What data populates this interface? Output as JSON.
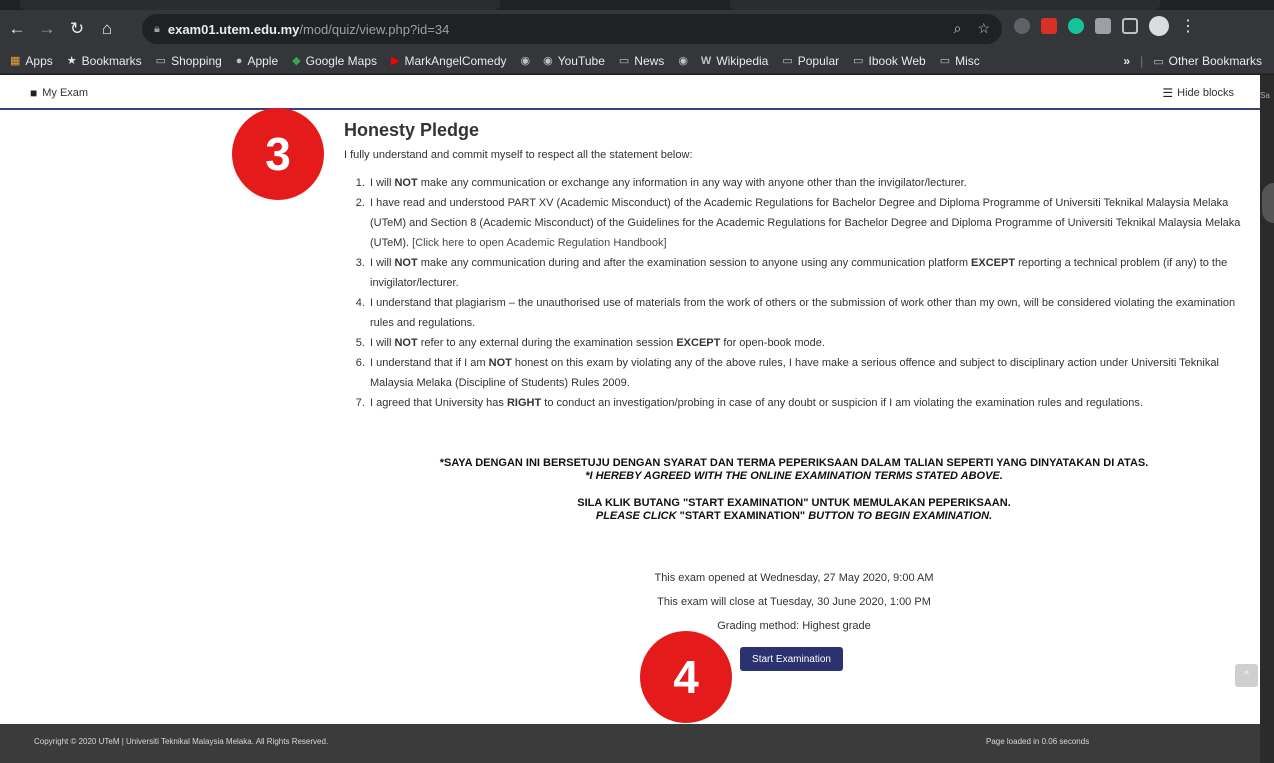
{
  "browser": {
    "url_domain": "exam01.utem.edu.my",
    "url_path": "/mod/quiz/view.php?id=34",
    "bookmarks": [
      {
        "label": "Apps",
        "icon": "apps-grid-icon"
      },
      {
        "label": "Bookmarks",
        "icon": "star-icon"
      },
      {
        "label": "Shopping",
        "icon": "folder-icon"
      },
      {
        "label": "Apple",
        "icon": "apple-icon"
      },
      {
        "label": "Google Maps",
        "icon": "maps-pin-icon"
      },
      {
        "label": "MarkAngelComedy",
        "icon": "youtube-icon"
      },
      {
        "label": "",
        "icon": "globe-icon"
      },
      {
        "label": "YouTube",
        "icon": "globe-icon"
      },
      {
        "label": "News",
        "icon": "folder-icon"
      },
      {
        "label": "",
        "icon": "globe-icon"
      },
      {
        "label": "Wikipedia",
        "icon": "wikipedia-icon"
      },
      {
        "label": "Popular",
        "icon": "folder-icon"
      },
      {
        "label": "Ibook Web",
        "icon": "folder-icon"
      },
      {
        "label": "Misc",
        "icon": "folder-icon"
      }
    ],
    "overflow_label": "»",
    "other_bookmarks": "Other Bookmarks"
  },
  "moodle": {
    "my_exam": "My Exam",
    "hide_blocks": "Hide blocks"
  },
  "pledge": {
    "title": "Honesty Pledge",
    "intro": "I fully understand and commit myself to respect all the statement below:",
    "items": [
      {
        "pre": "I will ",
        "bold": "NOT",
        "post": " make any communication or exchange any information in any way with anyone other than the invigilator/lecturer."
      },
      {
        "pre": "I have read and understood PART XV (Academic Misconduct) of the Academic Regulations for Bachelor Degree and Diploma Programme of Universiti Teknikal Malaysia Melaka (UTeM) and Section 8 (Academic Misconduct) of the Guidelines for the Academic Regulations for Bachelor Degree and Diploma Programme of Universiti Teknikal Malaysia Melaka (UTeM). ",
        "link": "[Click here to open Academic Regulation Handbook]"
      },
      {
        "pre": "I will ",
        "bold": "NOT",
        "mid": " make any communication during and after the examination session to anyone using any communication platform ",
        "bold2": "EXCEPT",
        "post": " reporting a technical problem (if any) to the invigilator/lecturer."
      },
      {
        "pre": "I understand that plagiarism – the unauthorised use of materials from the work of others or the submission of work other than my own, will be considered violating the examination rules and regulations."
      },
      {
        "pre": "I will ",
        "bold": "NOT",
        "mid": " refer to any external during the examination session ",
        "bold2": "EXCEPT",
        "post": " for open-book mode."
      },
      {
        "pre": "I understand that if I am ",
        "bold": "NOT",
        "post": " honest on this exam by violating any of the above rules, I have make a serious offence and subject to disciplinary action under Universiti Teknikal Malaysia Melaka (Discipline of Students) Rules 2009."
      },
      {
        "pre": "I agreed that University has ",
        "bold": "RIGHT",
        "post": " to conduct an investigation/probing in case of any doubt or suspicion if I am violating the examination rules and regulations."
      }
    ]
  },
  "agreement": {
    "line1": "*SAYA DENGAN INI BERSETUJU DENGAN SYARAT DAN TERMA PEPERIKSAAN DALAM TALIAN SEPERTI YANG DINYATAKAN DI ATAS.",
    "line2": "*I HEREBY AGREED WITH THE ONLINE EXAMINATION TERMS STATED ABOVE.",
    "line3": "SILA KLIK BUTANG \"START EXAMINATION\" UNTUK MEMULAKAN PEPERIKSAAN.",
    "line4a": "PLEASE CLICK",
    "line4b": " \"START EXAMINATION\" ",
    "line4c": "BUTTON TO BEGIN EXAMINATION."
  },
  "quiz_info": {
    "opened": "This exam opened at Wednesday, 27 May 2020, 9:00 AM",
    "closes": "This exam will close at Tuesday, 30 June 2020, 1:00 PM",
    "grading": "Grading method: Highest grade",
    "start_button": "Start Examination"
  },
  "footer": {
    "copyright": "Copyright © 2020 UTeM | Universiti Teknikal Malaysia Melaka. All Rights Reserved.",
    "loaded": "Page loaded in 0.06 seconds"
  },
  "badges": {
    "b3": "3",
    "b4": "4"
  },
  "side": {
    "text": "Sa"
  },
  "colors": {
    "accent": "#2a3270",
    "badge": "#e51a1a",
    "footer": "#3b3b3b"
  }
}
